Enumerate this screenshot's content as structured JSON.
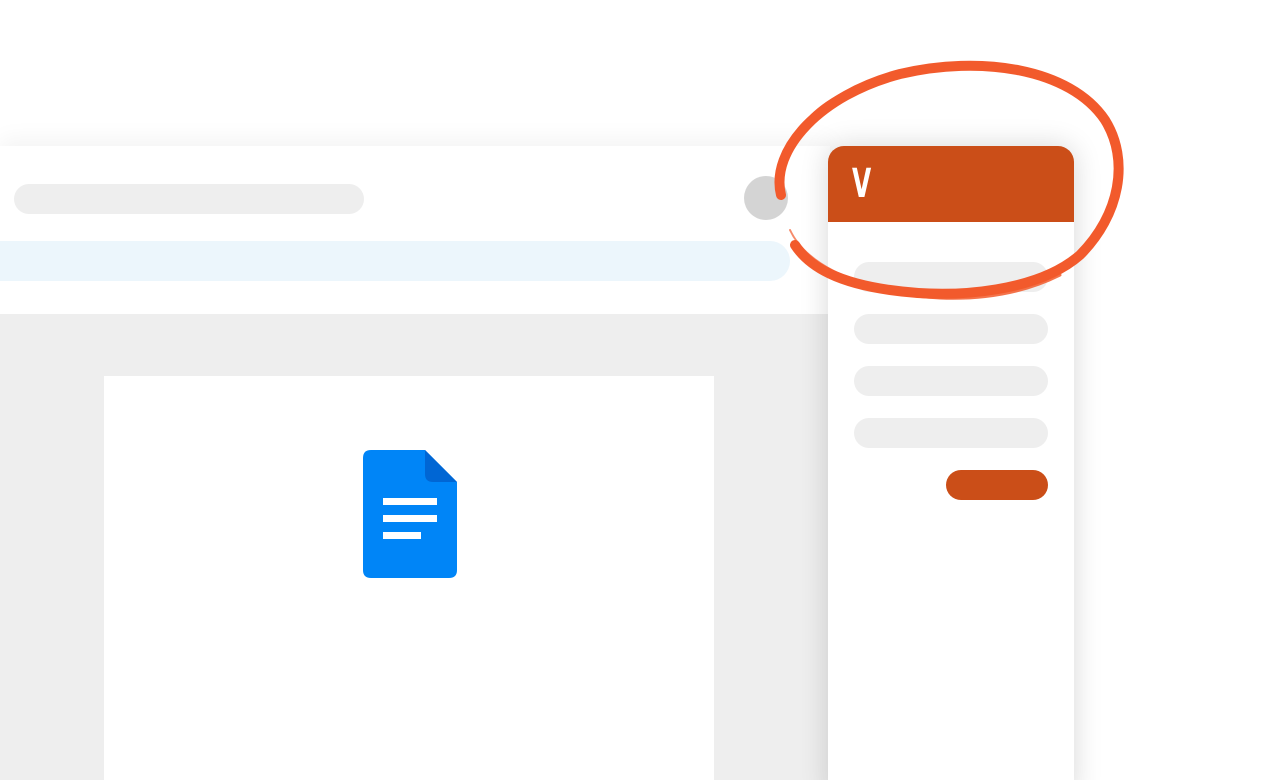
{
  "app": {
    "title": "",
    "toolbar": ""
  },
  "document": {
    "icon": "google-docs-icon",
    "icon_color": "#0085f7"
  },
  "side_panel": {
    "logo_letter": "V",
    "accent_color": "#cb4e18",
    "fields": [
      "",
      "",
      "",
      ""
    ],
    "action_label": ""
  },
  "annotation": {
    "type": "hand-drawn-circle",
    "color": "#f25a2c"
  }
}
